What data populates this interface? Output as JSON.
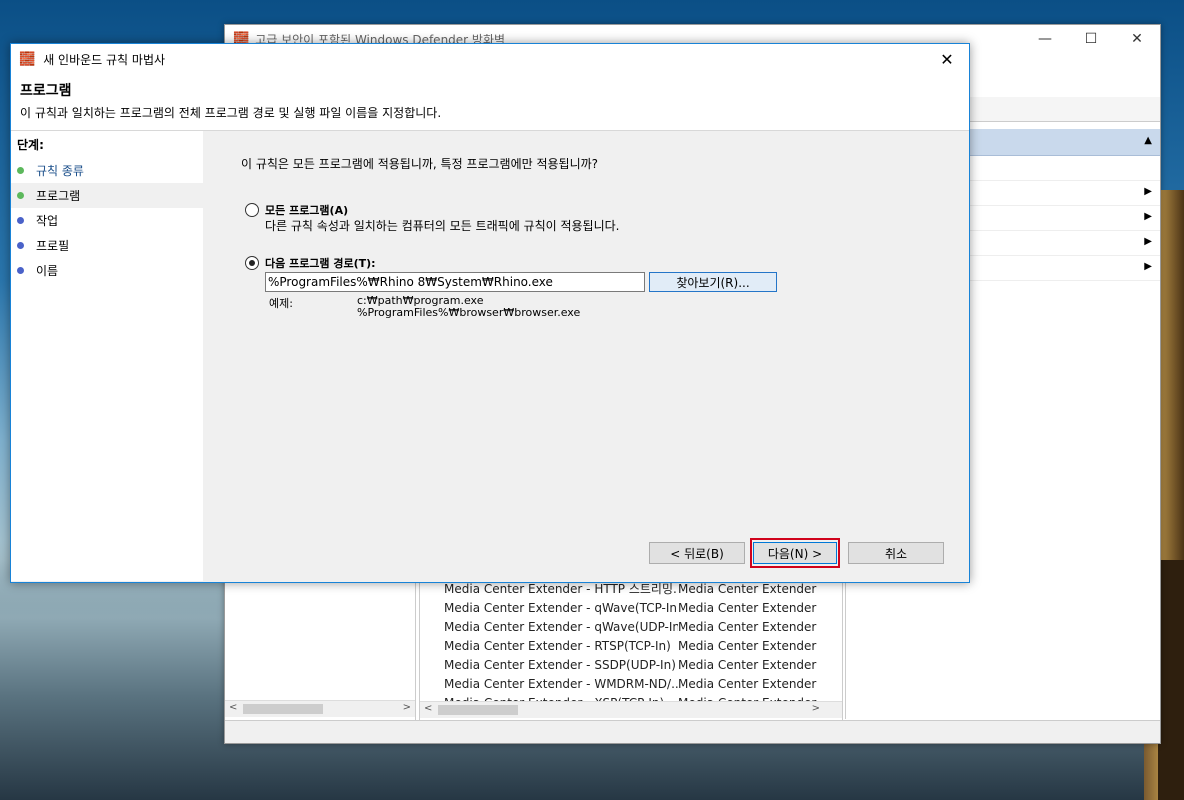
{
  "background_window": {
    "title": "고급 보안이 포함된 Windows Defender 방화벽",
    "list_rows": [
      {
        "name": "Media Center Extender - HTTP 스트리밍...",
        "group": "Media Center Extender"
      },
      {
        "name": "Media Center Extender - qWave(TCP-In)",
        "group": "Media Center Extender"
      },
      {
        "name": "Media Center Extender - qWave(UDP-In)",
        "group": "Media Center Extender"
      },
      {
        "name": "Media Center Extender - RTSP(TCP-In)",
        "group": "Media Center Extender"
      },
      {
        "name": "Media Center Extender - SSDP(UDP-In)",
        "group": "Media Center Extender"
      },
      {
        "name": "Media Center Extender - WMDRM-ND/...",
        "group": "Media Center Extender"
      },
      {
        "name": "Media Center Extender - XSP(TCP-In)",
        "group": "Media Center Extender"
      }
    ]
  },
  "dialog": {
    "title": "새 인바운드 규칙 마법사",
    "header_title": "프로그램",
    "header_subtitle": "이 규칙과 일치하는 프로그램의 전체 프로그램 경로 및 실행 파일 이름을 지정합니다.",
    "steps_label": "단계:",
    "steps": [
      {
        "label": "규칙 종류",
        "color": "#5cb85c"
      },
      {
        "label": "프로그램",
        "color": "#5cb85c"
      },
      {
        "label": "작업",
        "color": "#4a62c9"
      },
      {
        "label": "프로필",
        "color": "#4a62c9"
      },
      {
        "label": "이름",
        "color": "#4a62c9"
      }
    ],
    "question": "이 규칙은 모든 프로그램에 적용됩니까, 특정 프로그램에만 적용됩니까?",
    "option_all_label": "모든 프로그램(A)",
    "option_all_desc": "다른 규칙 속성과 일치하는 컴퓨터의 모든 트래픽에 규칙이 적용됩니다.",
    "option_path_label": "다음 프로그램 경로(T):",
    "path_value": "%ProgramFiles%₩Rhino 8₩System₩Rhino.exe",
    "browse_label": "찾아보기(R)...",
    "example_label": "예제:",
    "example_line1": "c:₩path₩program.exe",
    "example_line2": "%ProgramFiles%₩browser₩browser.exe",
    "back_label": "< 뒤로(B)",
    "next_label": "다음(N) >",
    "cancel_label": "취소"
  }
}
